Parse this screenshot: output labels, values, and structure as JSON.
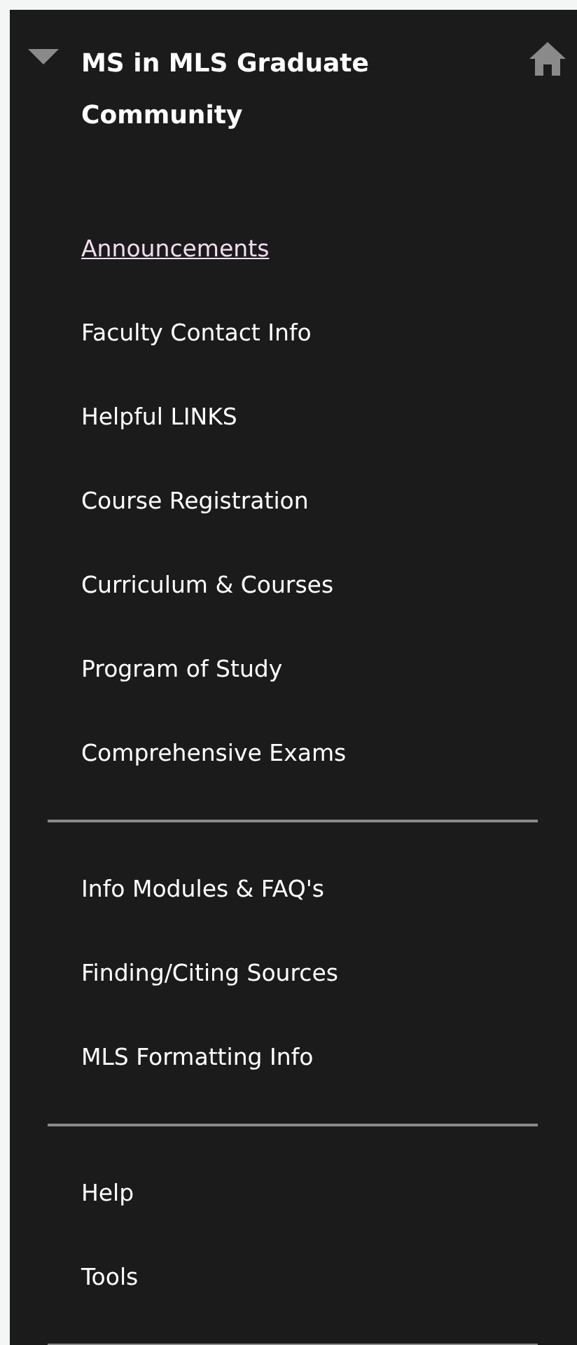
{
  "course": {
    "title": "MS in MLS Graduate Community",
    "expanded": true
  },
  "groups": [
    {
      "items": [
        {
          "label": "Announcements",
          "selected": true
        },
        {
          "label": "Faculty Contact Info",
          "selected": false
        },
        {
          "label": "Helpful LINKS",
          "selected": false
        },
        {
          "label": "Course Registration",
          "selected": false
        },
        {
          "label": "Curriculum & Courses",
          "selected": false
        },
        {
          "label": "Program of Study",
          "selected": false
        },
        {
          "label": "Comprehensive Exams",
          "selected": false
        }
      ]
    },
    {
      "items": [
        {
          "label": "Info Modules & FAQ's",
          "selected": false
        },
        {
          "label": "Finding/Citing Sources",
          "selected": false
        },
        {
          "label": "MLS Formatting Info",
          "selected": false
        }
      ]
    },
    {
      "items": [
        {
          "label": "Help",
          "selected": false
        },
        {
          "label": "Tools",
          "selected": false
        }
      ]
    }
  ]
}
